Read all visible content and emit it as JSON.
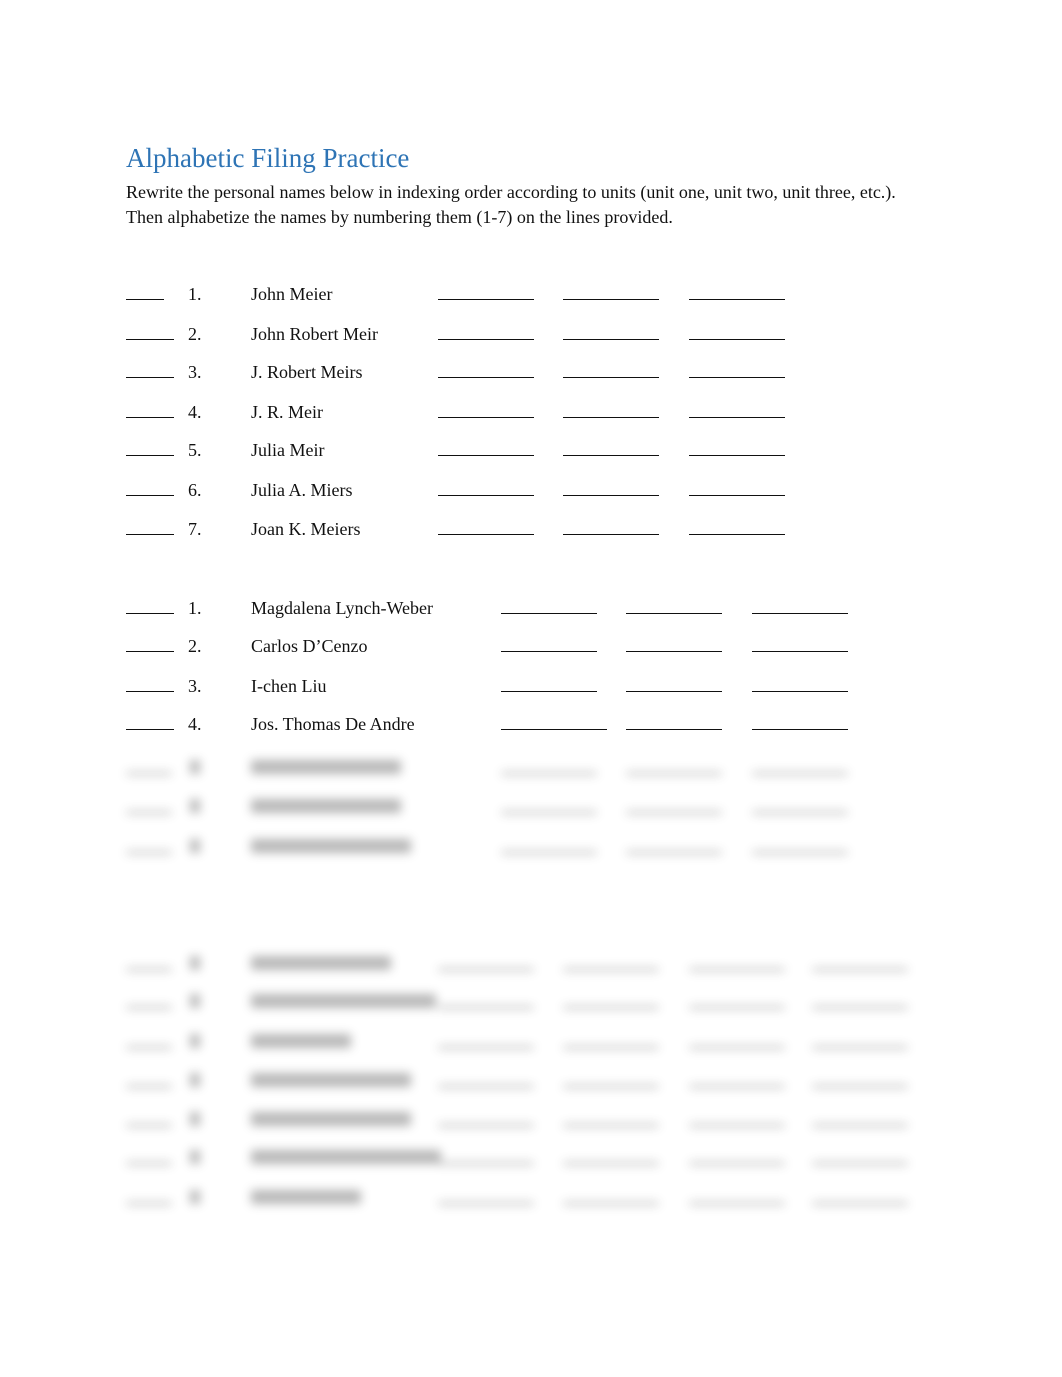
{
  "document": {
    "title": "Alphabetic Filing Practice",
    "instructions": "Rewrite the personal names below in indexing order according to units (unit one, unit two, unit three, etc.).  Then alphabetize the names by numbering them (1-7) on the lines provided."
  },
  "section1": {
    "rows": [
      {
        "number": "1.",
        "name": "John Meier"
      },
      {
        "number": "2.",
        "name": "John Robert Meir"
      },
      {
        "number": "3.",
        "name": "J. Robert Meirs"
      },
      {
        "number": "4.",
        "name": "J. R. Meir"
      },
      {
        "number": "5.",
        "name": "Julia Meir"
      },
      {
        "number": "6.",
        "name": "Julia A. Miers"
      },
      {
        "number": "7.",
        "name": "Joan K. Meiers"
      }
    ]
  },
  "section2": {
    "rows": [
      {
        "number": "1.",
        "name": "Magdalena Lynch-Weber"
      },
      {
        "number": "2.",
        "name": "Carlos D’Cenzo"
      },
      {
        "number": "3.",
        "name": "I-chen Liu"
      },
      {
        "number": "4.",
        "name": "Jos. Thomas De Andre"
      }
    ],
    "blurred_row_count": 3
  },
  "section3": {
    "blurred_row_count": 7
  }
}
